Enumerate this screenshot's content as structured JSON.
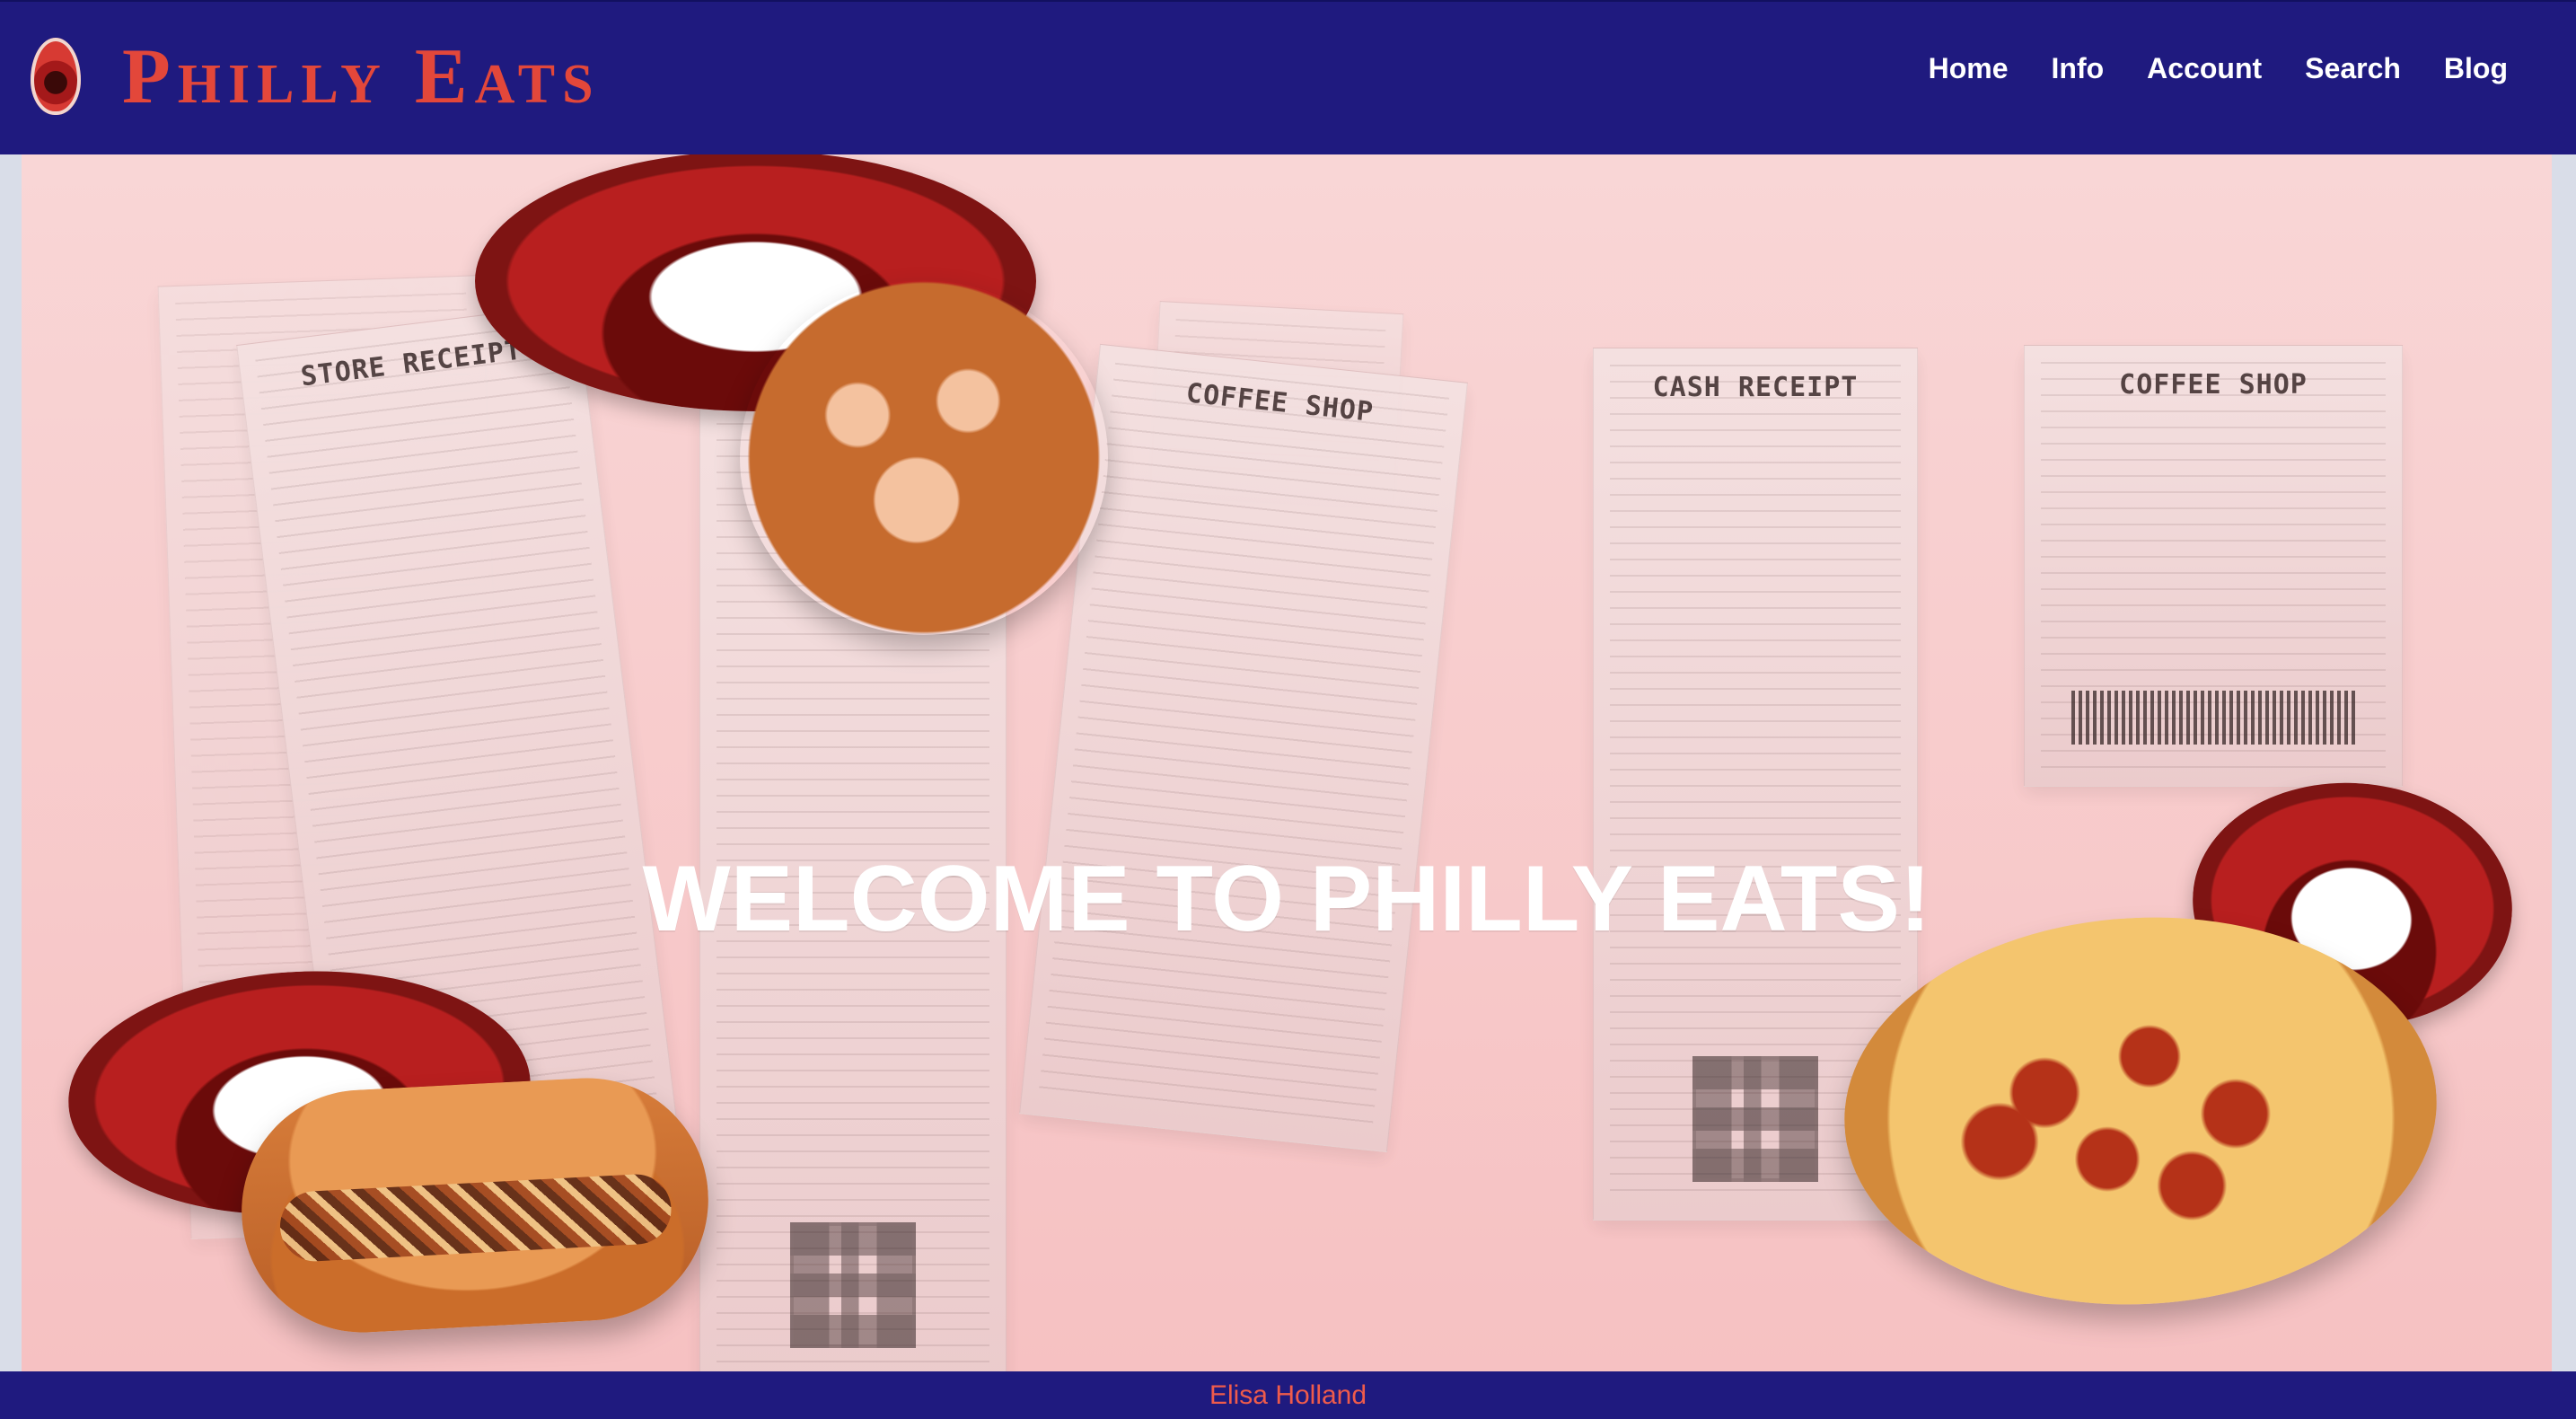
{
  "header": {
    "brand": {
      "title": "Philly Eats",
      "logo_icon": "mouth-logo-icon",
      "title_color": "#e3473a"
    },
    "nav": [
      {
        "label": "Home"
      },
      {
        "label": "Info"
      },
      {
        "label": "Account"
      },
      {
        "label": "Search"
      },
      {
        "label": "Blog"
      }
    ],
    "background": "#1f1a7f"
  },
  "hero": {
    "title": "WELCOME TO PHILLY EATS!",
    "collage": {
      "receipt_titles": [
        "STORE RECEIPT",
        "COFFEE SHOP",
        "CASH RECEIPT",
        "COFFEE SHOP"
      ],
      "food_icons": [
        "lips-icon",
        "pretzel-icon",
        "cheesesteak-icon",
        "pizza-icon"
      ],
      "receipt_icons": [
        "receipt-icon",
        "barcode-icon",
        "qr-code-icon"
      ]
    },
    "background_top": "#f9d6d6",
    "background_bottom": "#f6c1c2"
  },
  "footer": {
    "credit": "Elisa Holland",
    "background": "#1f1a7f",
    "text_color": "#ef5b4b"
  }
}
